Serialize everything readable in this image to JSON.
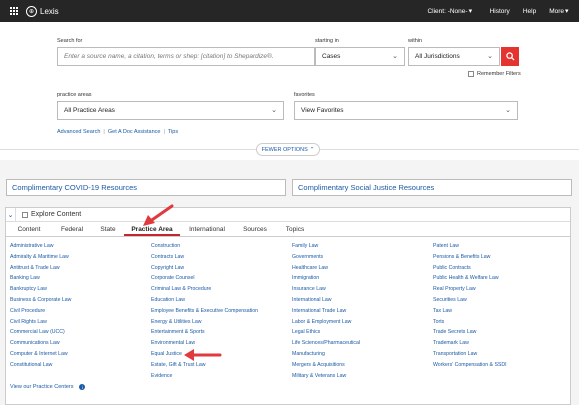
{
  "header": {
    "logo_text": "Lexis",
    "logo_mark": "⊕",
    "nav": [
      "Client: -None-",
      "History",
      "Help",
      "More"
    ],
    "caret": "▾"
  },
  "search": {
    "label": "Search for",
    "placeholder": "Enter a source name, a citation, terms or shep: [citation] to Shepardize®.",
    "starting_in_label": "starting in",
    "starting_in_value": "Cases",
    "within_label": "within",
    "within_value": "All Jurisdictions",
    "remember_filters": "Remember Filters"
  },
  "filters": {
    "practice_areas_label": "practice areas",
    "practice_areas_value": "All Practice Areas",
    "favorites_label": "favorites",
    "favorites_value": "View Favorites"
  },
  "links": [
    "Advanced Search",
    "Get A Doc Assistance",
    "Tips"
  ],
  "link_separator": "|",
  "fewer_options": "FEWER OPTIONS",
  "fewer_chevron": "⌃",
  "chevron": "⌄",
  "banners": [
    "Complimentary COVID-19 Resources",
    "Complimentary Social Justice Resources"
  ],
  "explore": {
    "title": "Explore Content",
    "collapse_icon": "⌄",
    "tabs": [
      "Content",
      "Federal",
      "State",
      "Practice Area",
      "International",
      "Sources",
      "Topics"
    ],
    "active_tab": "Practice Area",
    "columns": [
      [
        "Administrative Law",
        "Admiralty & Maritime Law",
        "Antitrust & Trade Law",
        "Banking Law",
        "Bankruptcy Law",
        "Business & Corporate Law",
        "Civil Procedure",
        "Civil Rights Law",
        "Commercial Law (UCC)",
        "Communications Law",
        "Computer & Internet Law",
        "Constitutional Law"
      ],
      [
        "Construction",
        "Contracts Law",
        "Copyright Law",
        "Corporate Counsel",
        "Criminal Law & Procedure",
        "Education Law",
        "Employee Benefits & Executive Compensation",
        "Energy & Utilities Law",
        "Entertainment & Sports",
        "Environmental Law",
        "Equal Justice",
        "Estate, Gift & Trust Law",
        "Evidence"
      ],
      [
        "Family Law",
        "Governments",
        "Healthcare Law",
        "Immigration",
        "Insurance Law",
        "International Law",
        "International Trade Law",
        "Labor & Employment Law",
        "Legal Ethics",
        "Life Sciences/Pharmaceutical",
        "Manufacturing",
        "Mergers & Acquisitions",
        "Military & Veterans Law"
      ],
      [
        "Patent Law",
        "Pensions & Benefits Law",
        "Public Contracts",
        "Public Health & Welfare Law",
        "Real Property Law",
        "Securities Law",
        "Tax Law",
        "Torts",
        "Trade Secrets Law",
        "Trademark Law",
        "Transportation Law",
        "Workers' Compensation & SSDI"
      ]
    ],
    "footer_link": "View our Practice Centers",
    "info_icon": "i"
  },
  "colors": {
    "topbar": "#262626",
    "link": "#1a5aa6",
    "accent": "#e3342f",
    "arrow": "#e0393e"
  }
}
